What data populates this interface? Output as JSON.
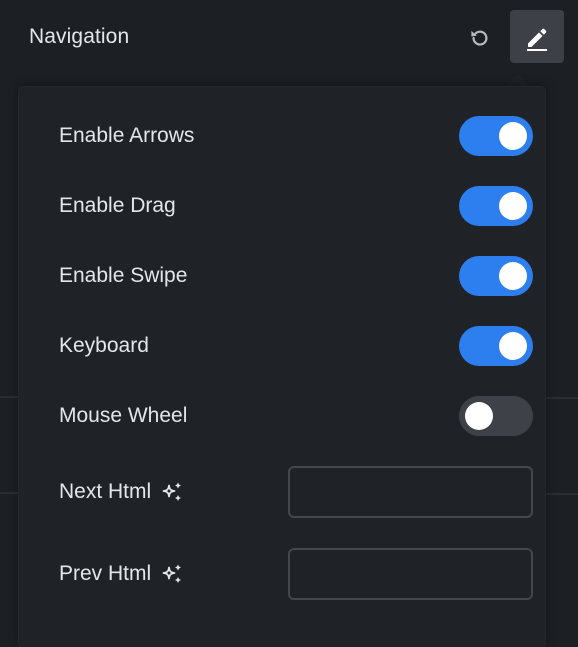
{
  "header": {
    "title": "Navigation",
    "reset_icon": "reset-icon",
    "edit_icon": "pencil-icon"
  },
  "colors": {
    "background": "#1c1f23",
    "panel": "#1f2226",
    "accent": "#2d7ff0",
    "toggle_off": "#3e4148",
    "button_bg": "#3d4047",
    "text": "#e4e6ea",
    "input_border": "#44474e"
  },
  "settings": {
    "toggles": [
      {
        "label": "Enable Arrows",
        "checked": true
      },
      {
        "label": "Enable Drag",
        "checked": true
      },
      {
        "label": "Enable Swipe",
        "checked": true
      },
      {
        "label": "Keyboard",
        "checked": true
      },
      {
        "label": "Mouse Wheel",
        "checked": false
      }
    ],
    "inputs": [
      {
        "label": "Next Html",
        "icon": "ai-sparkle-icon",
        "value": "",
        "placeholder": ""
      },
      {
        "label": "Prev Html",
        "icon": "ai-sparkle-icon",
        "value": "",
        "placeholder": ""
      }
    ]
  }
}
